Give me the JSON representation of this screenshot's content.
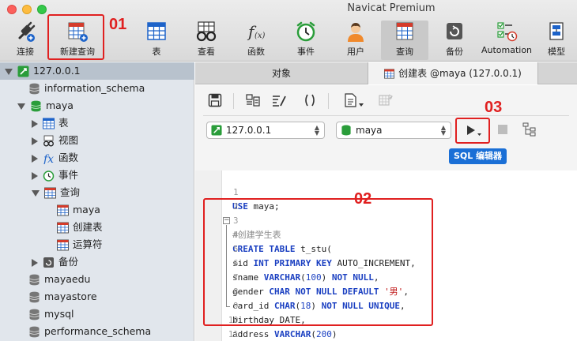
{
  "window": {
    "title": "Navicat Premium"
  },
  "toolbar": {
    "buttons": [
      {
        "label": "连接",
        "icon": "plug-icon"
      },
      {
        "label": "新建查询",
        "icon": "new-query-icon"
      },
      {
        "label": "表",
        "icon": "table-icon"
      },
      {
        "label": "查看",
        "icon": "view-glasses-icon"
      },
      {
        "label": "函数",
        "icon": "function-icon"
      },
      {
        "label": "事件",
        "icon": "alarm-clock-icon"
      },
      {
        "label": "用户",
        "icon": "user-icon"
      },
      {
        "label": "查询",
        "icon": "query-icon"
      },
      {
        "label": "备份",
        "icon": "backup-icon"
      },
      {
        "label": "Automation",
        "icon": "automation-icon"
      },
      {
        "label": "模型",
        "icon": "model-icon"
      }
    ],
    "active": "查询"
  },
  "annotations": {
    "a01": "01",
    "a02": "02",
    "a03": "03"
  },
  "tree": {
    "connection": "127.0.0.1",
    "items": [
      {
        "label": "information_schema",
        "icon": "database-icon"
      },
      {
        "label": "maya",
        "icon": "database-icon"
      },
      {
        "label": "表",
        "icon": "table-icon"
      },
      {
        "label": "视图",
        "icon": "view-glasses-icon"
      },
      {
        "label": "函数",
        "icon": "function-icon"
      },
      {
        "label": "事件",
        "icon": "alarm-clock-icon"
      },
      {
        "label": "查询",
        "icon": "query-icon"
      },
      {
        "label": "maya",
        "icon": "query-item-icon"
      },
      {
        "label": "创建表",
        "icon": "query-item-icon"
      },
      {
        "label": "运算符",
        "icon": "query-item-icon"
      },
      {
        "label": "备份",
        "icon": "backup-icon"
      },
      {
        "label": "mayaedu",
        "icon": "database-icon"
      },
      {
        "label": "mayastore",
        "icon": "database-icon"
      },
      {
        "label": "mysql",
        "icon": "database-icon"
      },
      {
        "label": "performance_schema",
        "icon": "database-icon"
      }
    ]
  },
  "tabs": {
    "objects": "对象",
    "query": "创建表 @maya (127.0.0.1)"
  },
  "editor": {
    "connection": "127.0.0.1",
    "database": "maya",
    "badge": "SQL 编辑器"
  },
  "code": {
    "line_numbers": [
      "1",
      "2",
      "3",
      "4",
      "5",
      "6",
      "7",
      "8",
      "9",
      "10",
      "11"
    ],
    "l1": {
      "kw": "USE",
      "rest": " maya;"
    },
    "l3": "#创建学生表",
    "l4": {
      "kw": "CREATE TABLE",
      "rest": " t_stu("
    },
    "l5": {
      "a": "sid ",
      "b": "INT PRIMARY KEY",
      "c": " AUTO_INCREMENT,"
    },
    "l6": {
      "a": "sname ",
      "b": "VARCHAR",
      "c": "(",
      "d": "100",
      "e": ") ",
      "f": "NOT NULL",
      "g": ","
    },
    "l7": {
      "a": "gender ",
      "b": "CHAR NOT NULL DEFAULT",
      "c": " ",
      "d": "'男'",
      "e": ","
    },
    "l8": {
      "a": "card_id ",
      "b": "CHAR",
      "c": "(",
      "d": "18",
      "e": ") ",
      "f": "NOT NULL UNIQUE",
      "g": ","
    },
    "l9": "birthday DATE,",
    "l10": {
      "a": "address ",
      "b": "VARCHAR",
      "c": "(",
      "d": "200",
      "e": ")"
    },
    "l11": ");"
  }
}
